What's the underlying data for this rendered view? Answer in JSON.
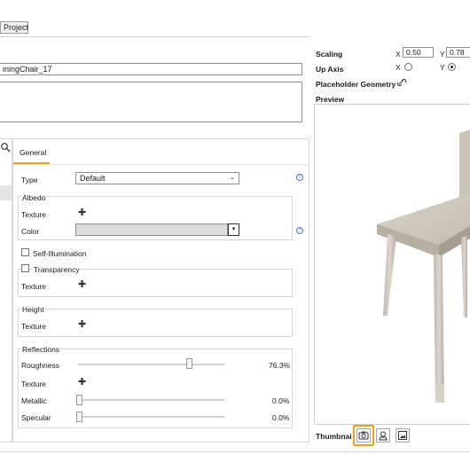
{
  "toolbar": {
    "project_button": "Project"
  },
  "asset": {
    "name": "iningChair_17"
  },
  "scaling": {
    "label": "Scaling",
    "x_label": "X",
    "x_value": "0.50",
    "y_label": "Y",
    "y_value": "0.78"
  },
  "up_axis": {
    "label": "Up Axis",
    "x_label": "X",
    "y_label": "Y",
    "selected": "Y"
  },
  "placeholder_geometry": {
    "label": "Placeholder Geometry",
    "icon": "link-icon"
  },
  "preview": {
    "label": "Preview"
  },
  "thumbnail": {
    "label": "Thumbnai",
    "icons": [
      "camera-icon",
      "render-icon",
      "image-icon"
    ]
  },
  "material": {
    "tab": "General",
    "type_label": "Type",
    "type_value": "Default",
    "albedo": {
      "section": "Albedo",
      "texture_label": "Texture",
      "color_label": "Color"
    },
    "self_illumination": {
      "label": "Self-Illumination",
      "checked": false
    },
    "transparency": {
      "label": "Transparency",
      "checked": false,
      "texture_label": "Texture"
    },
    "height": {
      "section": "Height",
      "texture_label": "Texture"
    },
    "reflections": {
      "section": "Reflections",
      "roughness_label": "Roughness",
      "roughness_value": "76.3%",
      "roughness_fraction": 0.763,
      "texture_label": "Texture",
      "metallic_label": "Metallic",
      "metallic_value": "0.0%",
      "metallic_fraction": 0.0,
      "specular_label": "Specular",
      "specular_value": "0.0%",
      "specular_fraction": 0.0
    }
  },
  "colors": {
    "accent": "#f0a020",
    "tab_underline": "#f0a020",
    "help": "#4a7cc9",
    "chair": "#cfc6bc"
  }
}
